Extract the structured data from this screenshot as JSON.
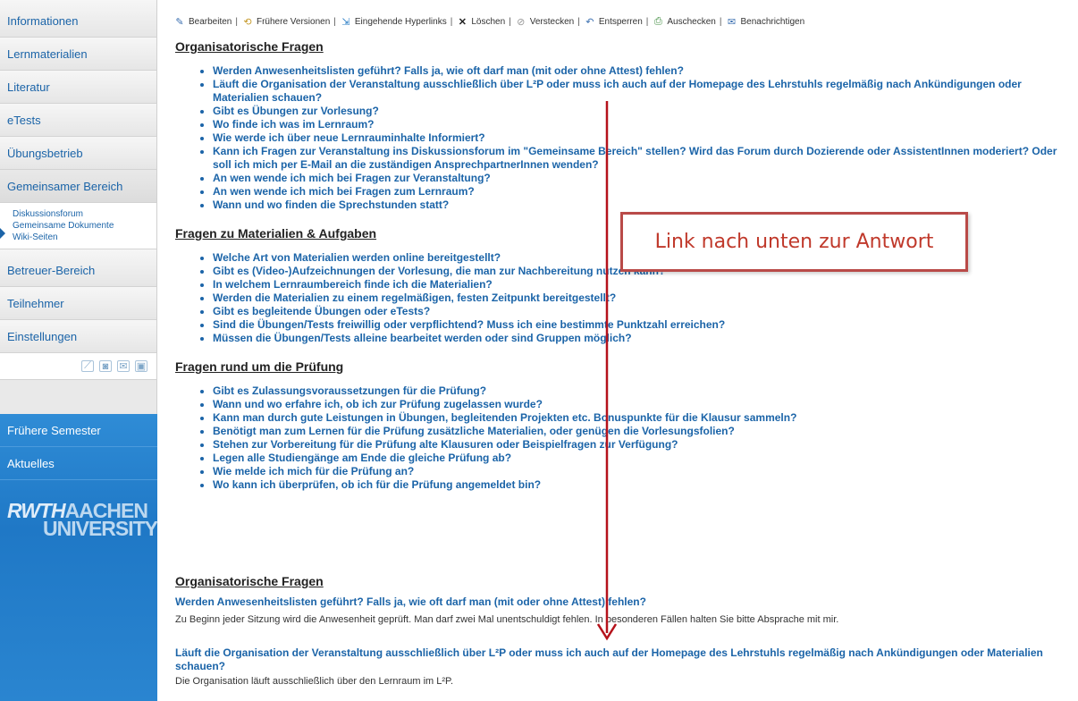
{
  "sidebar": {
    "items": [
      {
        "label": "Informationen"
      },
      {
        "label": "Lernmaterialien"
      },
      {
        "label": "Literatur"
      },
      {
        "label": "eTests"
      },
      {
        "label": "Übungsbetrieb"
      },
      {
        "label": "Gemeinsamer Bereich"
      }
    ],
    "subitems": [
      {
        "label": "Diskussionsforum"
      },
      {
        "label": "Gemeinsame Dokumente"
      },
      {
        "label": "Wiki-Seiten"
      }
    ],
    "items2": [
      {
        "label": "Betreuer-Bereich"
      },
      {
        "label": "Teilnehmer"
      },
      {
        "label": "Einstellungen"
      }
    ],
    "blue_items": [
      {
        "label": "Frühere Semester"
      },
      {
        "label": "Aktuelles"
      }
    ],
    "logo_line1_a": "RWTH",
    "logo_line1_b": "AACHEN",
    "logo_line2": "UNIVERSITY"
  },
  "toolbar": {
    "items": [
      {
        "label": "Bearbeiten",
        "icon": "edit-icon"
      },
      {
        "label": "Frühere Versionen",
        "icon": "versions-icon"
      },
      {
        "label": "Eingehende Hyperlinks",
        "icon": "hyperlinks-icon"
      },
      {
        "label": "Löschen",
        "icon": "delete-icon"
      },
      {
        "label": "Verstecken",
        "icon": "hide-icon"
      },
      {
        "label": "Entsperren",
        "icon": "unlock-icon"
      },
      {
        "label": "Auschecken",
        "icon": "checkout-icon"
      },
      {
        "label": "Benachrichtigen",
        "icon": "notify-icon"
      }
    ]
  },
  "sections": [
    {
      "title": "Organisatorische Fragen",
      "questions": [
        "Werden Anwesenheitslisten geführt? Falls ja, wie oft darf man (mit oder ohne Attest) fehlen?",
        "Läuft die Organisation der Veranstaltung ausschließlich über L²P oder muss ich auch auf der Homepage des Lehrstuhls regelmäßig nach Ankündigungen oder Materialien schauen?",
        "Gibt es Übungen zur Vorlesung?",
        "Wo finde ich was im Lernraum?",
        "Wie werde ich über neue Lernrauminhalte Informiert?",
        "Kann ich Fragen zur Veranstaltung ins Diskussionsforum im \"Gemeinsame Bereich\" stellen? Wird das Forum durch Dozierende oder AssistentInnen moderiert? Oder soll ich mich per E-Mail an die zuständigen AnsprechpartnerInnen wenden?",
        "An wen wende ich mich bei Fragen zur Veranstaltung?",
        "An wen wende ich mich bei Fragen zum Lernraum?",
        "Wann und wo finden die Sprechstunden statt?"
      ]
    },
    {
      "title": "Fragen zu Materialien & Aufgaben",
      "questions": [
        "Welche Art von Materialien werden online bereitgestellt?",
        "Gibt es (Video-)Aufzeichnungen der Vorlesung, die man zur Nachbereitung nutzen kann?",
        "In welchem Lernraumbereich finde ich die Materialien?",
        "Werden die Materialien zu einem regelmäßigen, festen Zeitpunkt bereitgestellt?",
        "Gibt es begleitende Übungen oder eTests?",
        "Sind die Übungen/Tests freiwillig oder verpflichtend? Muss ich eine bestimmte Punktzahl erreichen?",
        "Müssen die Übungen/Tests alleine bearbeitet werden oder sind Gruppen möglich?"
      ]
    },
    {
      "title": "Fragen rund um die Prüfung",
      "questions": [
        "Gibt es Zulassungsvoraussetzungen für die Prüfung?",
        "Wann und wo erfahre ich, ob ich zur Prüfung zugelassen wurde?",
        "Kann man durch gute Leistungen in Übungen, begleitenden Projekten etc. Bonuspunkte für die Klausur sammeln?",
        "Benötigt man zum Lernen für die Prüfung zusätzliche Materialien, oder genügen die Vorlesungsfolien?",
        "Stehen zur Vorbereitung für die Prüfung alte Klausuren oder Beispielfragen zur Verfügung?",
        "Legen alle Studiengänge am Ende die gleiche Prüfung ab?",
        "Wie melde ich mich für die Prüfung an?",
        "Wo kann ich überprüfen, ob ich für die Prüfung angemeldet bin?"
      ]
    }
  ],
  "answers": {
    "title": "Organisatorische Fragen",
    "entries": [
      {
        "question": "Werden Anwesenheitslisten geführt? Falls ja, wie oft darf man (mit oder ohne Attest) fehlen?",
        "answer": "Zu Beginn jeder Sitzung wird die Anwesenheit geprüft. Man darf zwei Mal unentschuldigt fehlen. In besonderen Fällen halten Sie bitte Absprache mit mir."
      },
      {
        "question": "Läuft die Organisation der Veranstaltung ausschließlich über L²P oder muss ich auch auf der Homepage des Lehrstuhls regelmäßig nach Ankündigungen oder Materialien schauen?",
        "answer": "Die Organisation läuft ausschließlich über den Lernraum im L²P."
      }
    ]
  },
  "annotation": {
    "callout_text": "Link nach unten zur Antwort",
    "color": "#b5121b"
  }
}
